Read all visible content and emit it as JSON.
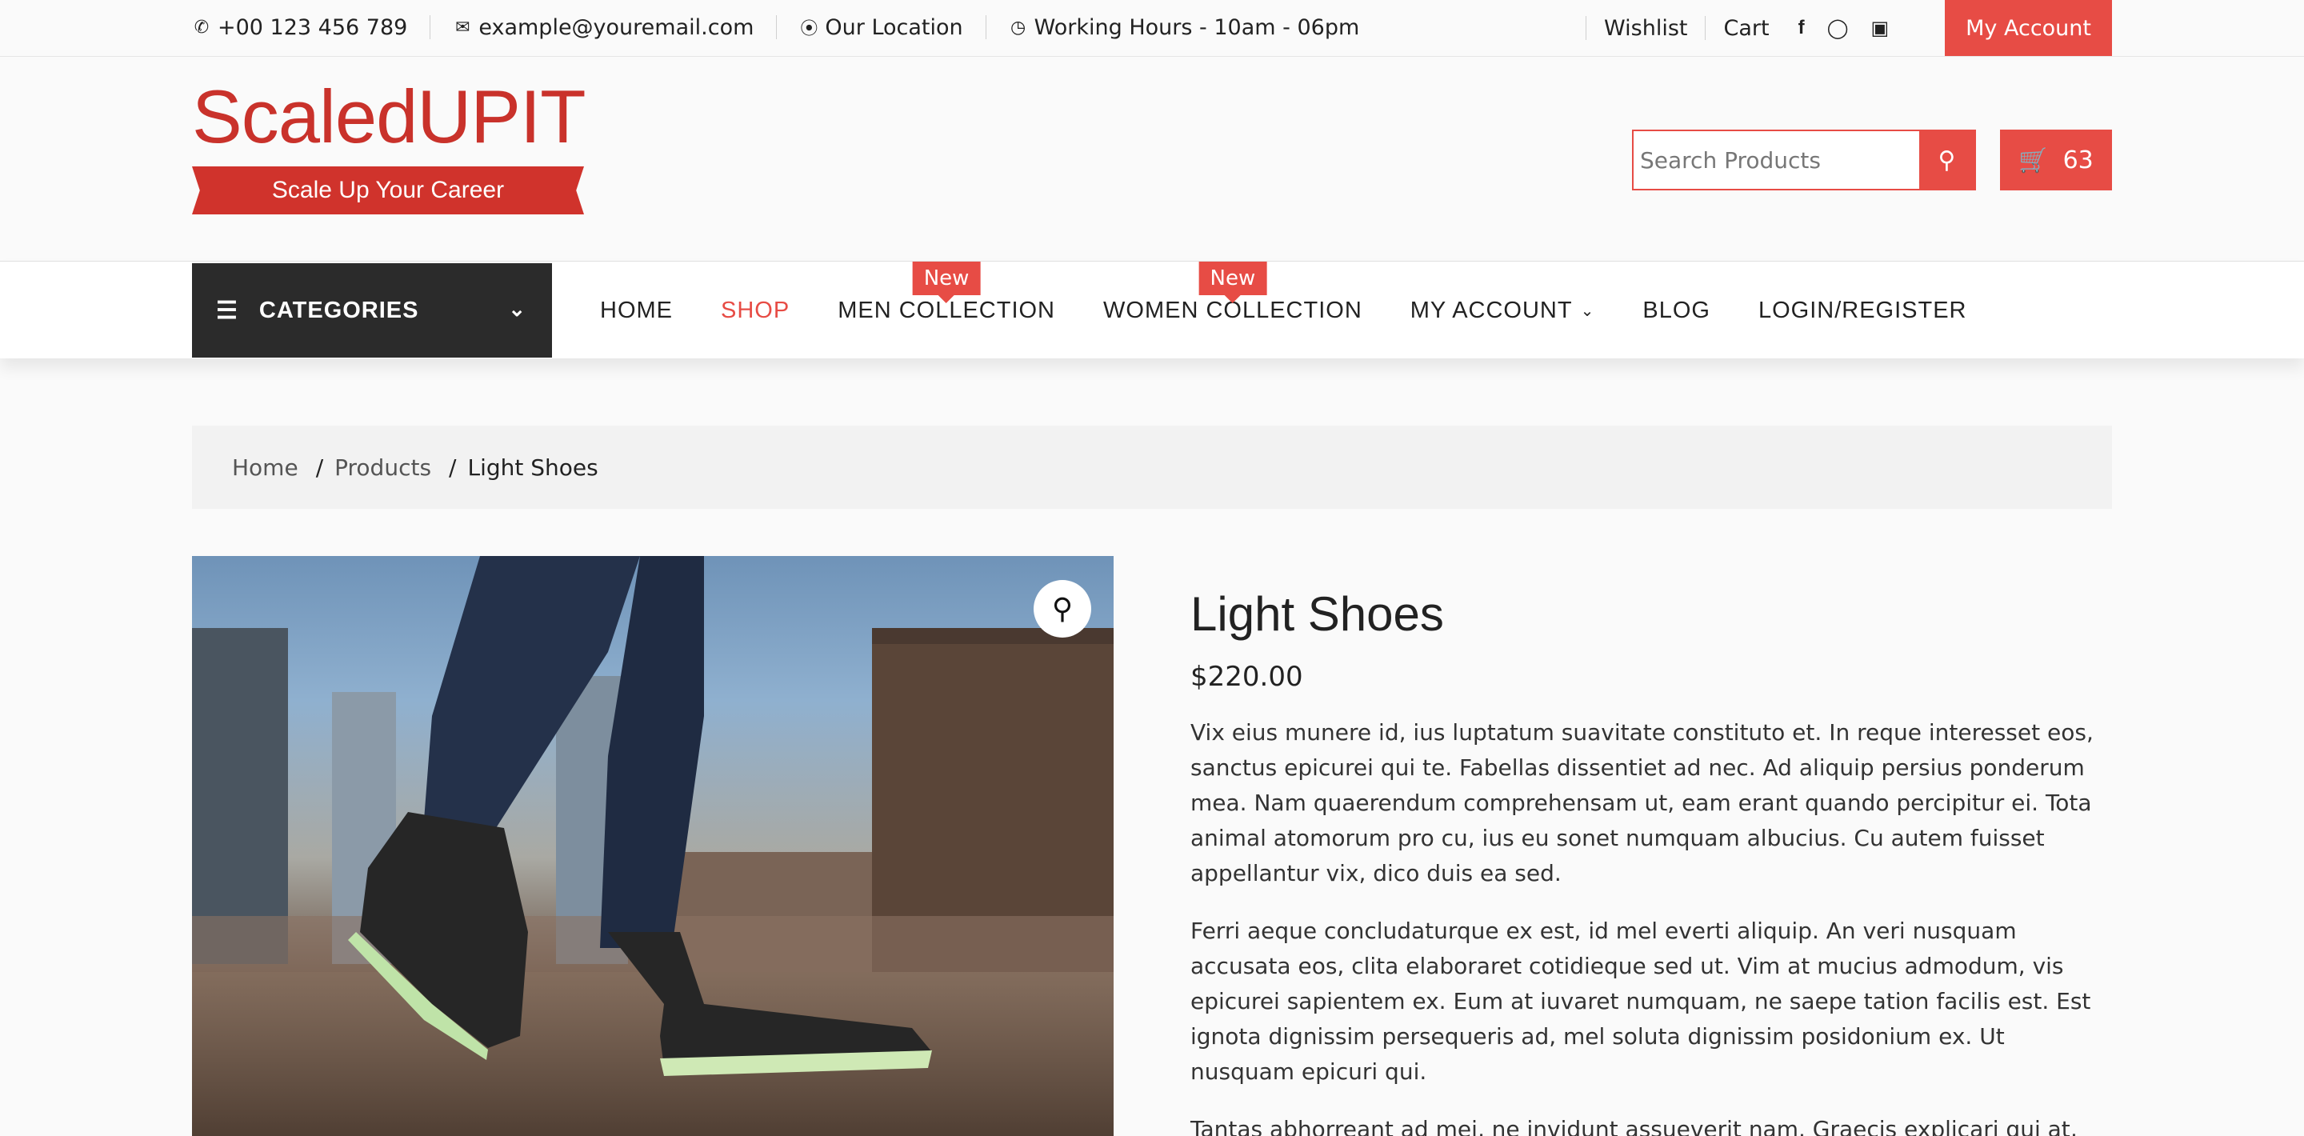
{
  "topbar": {
    "phone": "+00 123 456 789",
    "email": "example@youremail.com",
    "location": "Our Location",
    "hours": "Working Hours - 10am - 06pm",
    "wishlist": "Wishlist",
    "cart": "Cart",
    "social": [
      "facebook-icon",
      "instagram-icon",
      "camera-icon"
    ],
    "account_button": "My Account"
  },
  "header": {
    "brand": "ScaledUPIT",
    "tagline": "Scale Up Your Career",
    "search_placeholder": "Search Products",
    "cart_count": "63"
  },
  "nav": {
    "categories_label": "CATEGORIES",
    "items": [
      {
        "label": "HOME"
      },
      {
        "label": "SHOP",
        "active": true
      },
      {
        "label": "MEN COLLECTION",
        "badge": "New"
      },
      {
        "label": "WOMEN COLLECTION",
        "badge": "New"
      },
      {
        "label": "MY ACCOUNT",
        "dropdown": true
      },
      {
        "label": "BLOG"
      },
      {
        "label": "LOGIN/REGISTER"
      }
    ]
  },
  "breadcrumb": {
    "home": "Home",
    "products": "Products",
    "current": "Light Shoes",
    "separator": "/"
  },
  "product": {
    "title": "Light Shoes",
    "price": "$220.00",
    "paragraphs": [
      "Vix eius munere id, ius luptatum suavitate constituto et. In reque interesset eos, sanctus epicurei qui te. Fabellas dissentiet ad nec. Ad aliquip persius ponderum mea. Nam quaerendum comprehensam ut, eam erant quando percipitur ei. Tota animal atomorum pro cu, ius eu sonet numquam albucius. Cu autem fuisset appellantur vix, dico duis ea sed.",
      "Ferri aeque concludaturque ex est, id mel everti aliquip. An veri nusquam accusata eos, clita elaboraret cotidieque sed ut. Vim at mucius admodum, vis epicurei sapientem ex. Eum at iuvaret numquam, ne saepe tation facilis est. Est ignota dignissim persequeris ad, mel soluta dignissim posidonium ex. Ut nusquam epicuri qui.",
      "Tantas abhorreant ad mei, ne invidunt assueverit nam. Graecis explicari qui at, eum in"
    ]
  },
  "colors": {
    "accent": "#e74c45",
    "dark": "#2b2b2b"
  }
}
